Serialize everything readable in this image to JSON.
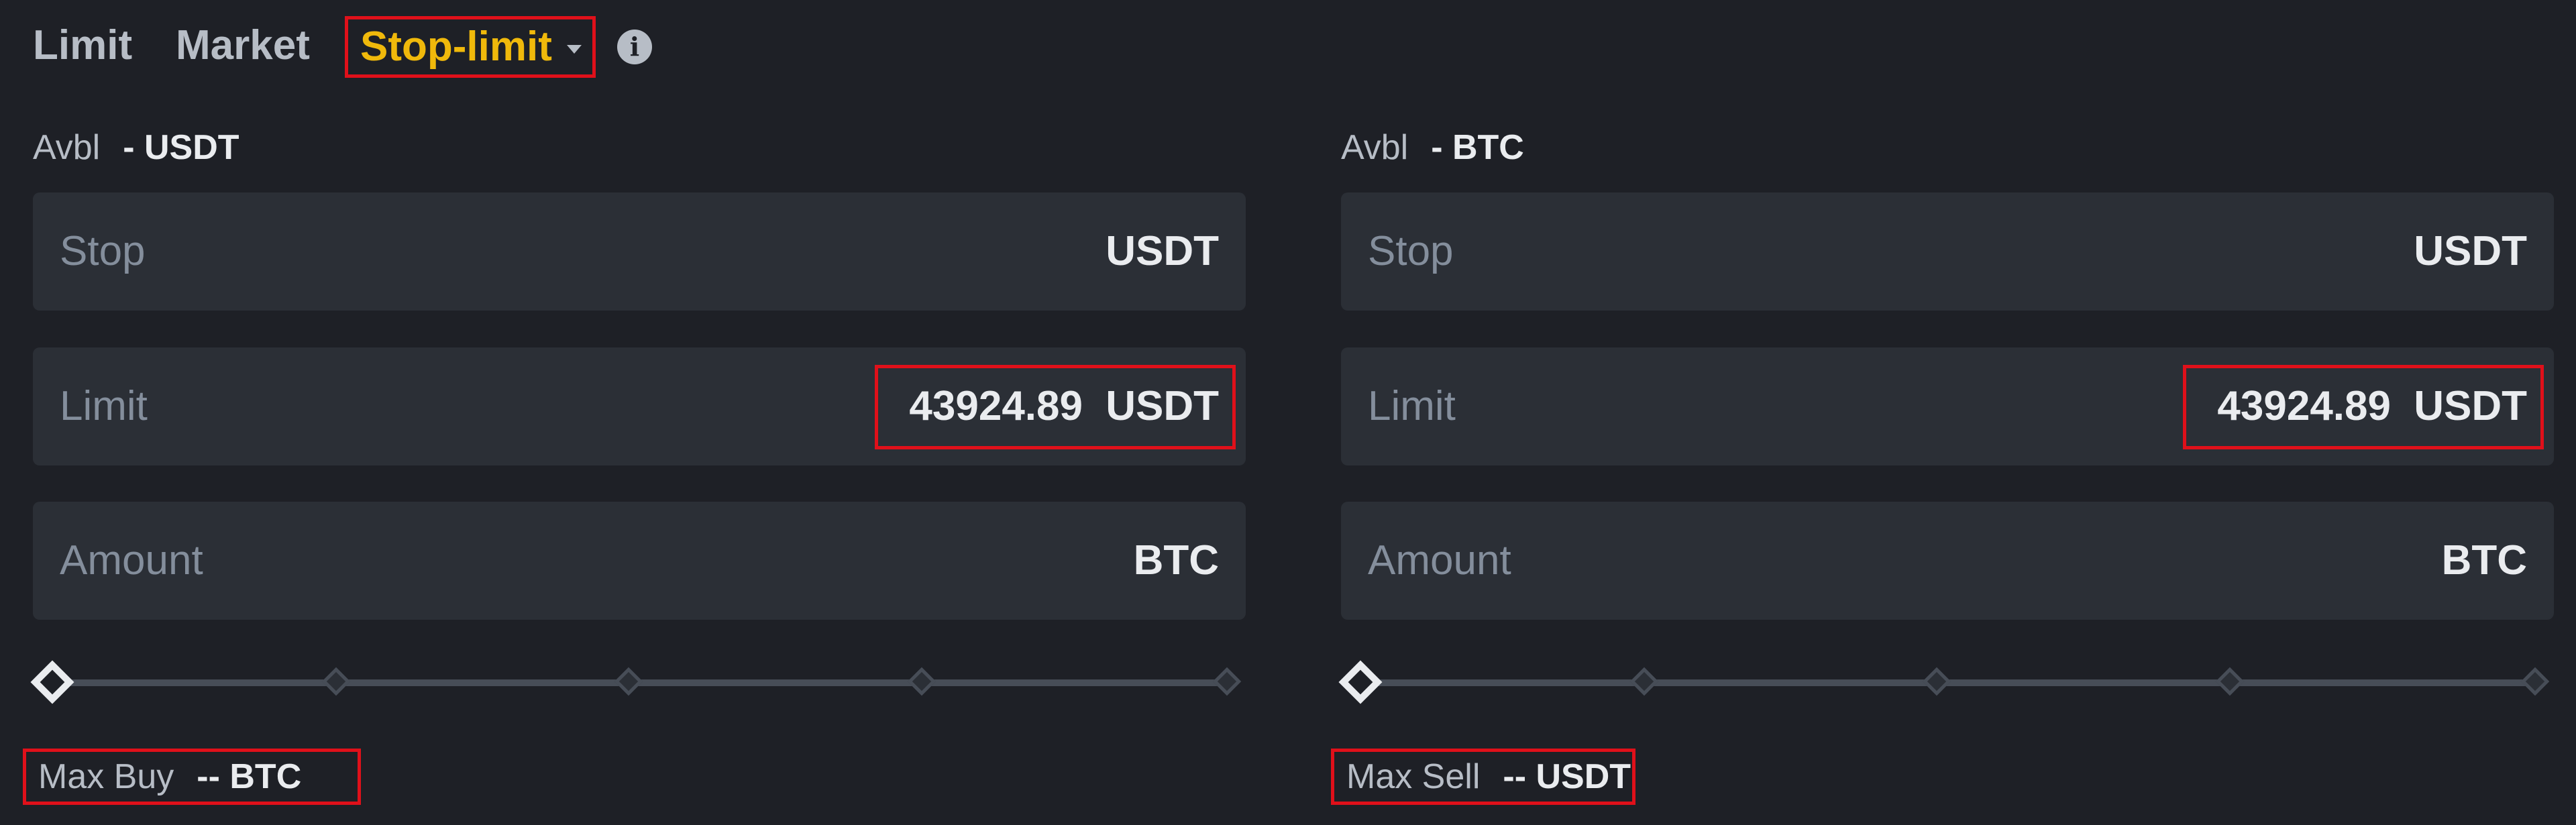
{
  "tabs": {
    "limit": "Limit",
    "market": "Market",
    "stop_limit": "Stop-limit",
    "active": "stop_limit"
  },
  "buy": {
    "avbl_label": "Avbl",
    "avbl_value": "- USDT",
    "stop": {
      "label": "Stop",
      "unit": "USDT",
      "value": ""
    },
    "limit": {
      "label": "Limit",
      "unit": "USDT",
      "value": "43924.89"
    },
    "amount": {
      "label": "Amount",
      "unit": "BTC",
      "value": ""
    },
    "slider_percent": 0,
    "max_label": "Max Buy",
    "max_value": "-- BTC"
  },
  "sell": {
    "avbl_label": "Avbl",
    "avbl_value": "- BTC",
    "stop": {
      "label": "Stop",
      "unit": "USDT",
      "value": ""
    },
    "limit": {
      "label": "Limit",
      "unit": "USDT",
      "value": "43924.89"
    },
    "amount": {
      "label": "Amount",
      "unit": "BTC",
      "value": ""
    },
    "slider_percent": 0,
    "max_label": "Max Sell",
    "max_value": "-- USDT"
  },
  "colors": {
    "background": "#1e2026",
    "input_bg": "#2b2f36",
    "accent": "#f0b90b",
    "highlight_box": "#e0101a",
    "muted_text": "#848e9c"
  },
  "icons": {
    "info": "info-icon",
    "dropdown": "chevron-down-icon"
  }
}
